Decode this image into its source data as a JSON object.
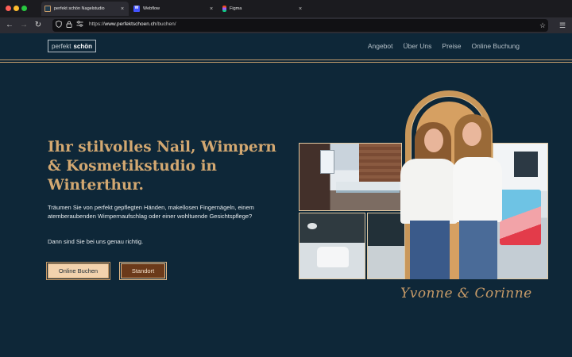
{
  "browser": {
    "tabs": [
      {
        "title": "perfekt schön Nagelstudio",
        "favicon": "perfekt-favicon",
        "active": true
      },
      {
        "title": "Webflow",
        "favicon": "webflow-favicon",
        "active": false
      },
      {
        "title": "Figma",
        "favicon": "figma-favicon",
        "active": false
      }
    ],
    "url": {
      "scheme": "https://",
      "host": "www.perfektschoen.ch",
      "path": "/buchen/"
    }
  },
  "site": {
    "logo": {
      "light": "perfekt",
      "bold": "schön"
    },
    "nav": [
      "Angebot",
      "Über Uns",
      "Preise",
      "Online Buchung"
    ],
    "hero": {
      "headline": "Ihr stilvolles Nail, Wimpern & Kosmetikstudio in Winterthur.",
      "lead": "Träumen Sie von perfekt gepflegten Händen, makellosen Fingernägeln, einem atemberaubenden Wimpernaufschlag oder einer wohltuende Gesichtspflege?",
      "lead2": "Dann sind Sie bei uns genau richtig.",
      "buttons": {
        "primary": "Online Buchen",
        "secondary": "Standort"
      },
      "signature": "Yvonne & Corinne"
    }
  },
  "colors": {
    "page_bg": "#0e2738",
    "accent_gold": "#c79b68",
    "headline": "#d3a871"
  }
}
